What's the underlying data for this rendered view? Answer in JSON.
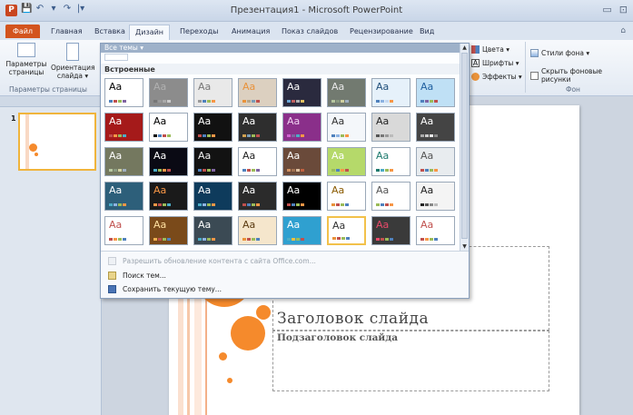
{
  "window": {
    "app_badge": "P",
    "title": "Презентация1 - Microsoft PowerPoint",
    "qat": [
      "💾",
      "↶",
      "▾",
      "↷",
      "|▾"
    ],
    "controls": [
      "▭",
      "⊡"
    ]
  },
  "tabs": [
    "Файл",
    "Главная",
    "Вставка",
    "Дизайн",
    "Переходы",
    "Анимация",
    "Показ слайдов",
    "Рецензирование",
    "Вид"
  ],
  "active_tab": "Дизайн",
  "ribbon": {
    "page_setup_btn": "Параметры страницы",
    "orientation_btn": "Ориентация слайда ▾",
    "page_setup_group": "Параметры страницы",
    "colors": "Цвета ▾",
    "fonts": "Шрифты ▾",
    "effects": "Эффекты ▾",
    "bg_styles": "Стили фона ▾",
    "hide_bg": "Скрыть фоновые рисунки",
    "bg_group": "Фон"
  },
  "theme_gallery": {
    "header": "Все темы ▾",
    "section": "Встроенные",
    "sample_text": "Aa",
    "themes": [
      {
        "bg": "#ffffff",
        "fg": "#000000",
        "dots": [
          "#4f81bd",
          "#c0504d",
          "#9bbb59",
          "#8064a2"
        ]
      },
      {
        "bg": "#8c8c8c",
        "fg": "#b0b0b0",
        "dots": [
          "#777",
          "#999",
          "#aaa",
          "#ccc"
        ]
      },
      {
        "bg": "#e9e9e9",
        "fg": "#777777",
        "dots": [
          "#999",
          "#4f81bd",
          "#9bbb59",
          "#f79646"
        ]
      },
      {
        "bg": "#dcd0c0",
        "fg": "#e9923a",
        "dots": [
          "#e9923a",
          "#b5a58a",
          "#7a9cb8",
          "#c0504d"
        ]
      },
      {
        "bg": "#2a2a3e",
        "fg": "#ffffff",
        "dots": [
          "#6aa6d6",
          "#c06060",
          "#b0b0b0",
          "#e0c060"
        ]
      },
      {
        "bg": "#727a70",
        "fg": "#e8e8e8",
        "dots": [
          "#b7c7a0",
          "#8a9a80",
          "#d0d0a0",
          "#a0b0c0"
        ]
      },
      {
        "bg": "#e6f1fa",
        "fg": "#1f4e79",
        "dots": [
          "#4f81bd",
          "#8db3e2",
          "#c6d9f1",
          "#f79646"
        ]
      },
      {
        "bg": "#bfe0f5",
        "fg": "#1f5f9f",
        "dots": [
          "#4f81bd",
          "#8064a2",
          "#9bbb59",
          "#c0504d"
        ]
      },
      {
        "bg": "#a51a1a",
        "fg": "#ffffff",
        "dots": [
          "#c0504d",
          "#f79646",
          "#9bbb59",
          "#4bacc6"
        ]
      },
      {
        "bg": "#ffffff",
        "fg": "#000000",
        "dots": [
          "#000",
          "#4f81bd",
          "#c0504d",
          "#9bbb59"
        ]
      },
      {
        "bg": "#111111",
        "fg": "#ffffff",
        "dots": [
          "#c0504d",
          "#4f81bd",
          "#9bbb59",
          "#f79646"
        ]
      },
      {
        "bg": "#2e2e2e",
        "fg": "#ffffff",
        "dots": [
          "#d0a050",
          "#7a9cb8",
          "#9bbb59",
          "#c0504d"
        ]
      },
      {
        "bg": "#8a2f8a",
        "fg": "#f0d0f0",
        "dots": [
          "#d060d0",
          "#8064a2",
          "#4bacc6",
          "#f79646"
        ]
      },
      {
        "bg": "#f4f7fa",
        "fg": "#333333",
        "dots": [
          "#4f81bd",
          "#8db3e2",
          "#9bbb59",
          "#f79646"
        ]
      },
      {
        "bg": "#d9d9d9",
        "fg": "#222222",
        "dots": [
          "#555",
          "#777",
          "#999",
          "#bbb"
        ]
      },
      {
        "bg": "#444444",
        "fg": "#ffffff",
        "dots": [
          "#aaa",
          "#ccc",
          "#eee",
          "#888"
        ]
      },
      {
        "bg": "#74785f",
        "fg": "#ffffff",
        "dots": [
          "#b7c7a0",
          "#8a9a80",
          "#d0d0a0",
          "#a0b0c0"
        ]
      },
      {
        "bg": "#0a0a14",
        "fg": "#ffffff",
        "dots": [
          "#4bacc6",
          "#9bbb59",
          "#f79646",
          "#c0504d"
        ]
      },
      {
        "bg": "#121212",
        "fg": "#f2f2f2",
        "dots": [
          "#4f81bd",
          "#c0504d",
          "#9bbb59",
          "#8064a2"
        ]
      },
      {
        "bg": "#ffffff",
        "fg": "#222222",
        "dots": [
          "#4f81bd",
          "#c0504d",
          "#9bbb59",
          "#8064a2"
        ]
      },
      {
        "bg": "#6a4a3a",
        "fg": "#ffffff",
        "dots": [
          "#d09060",
          "#a07050",
          "#e0c0a0",
          "#c06040"
        ]
      },
      {
        "bg": "#b5d96a",
        "fg": "#ffffff",
        "dots": [
          "#9bbb59",
          "#4f81bd",
          "#f79646",
          "#c0504d"
        ]
      },
      {
        "bg": "#ffffff",
        "fg": "#1e7a6e",
        "dots": [
          "#1e7a6e",
          "#4bacc6",
          "#9bbb59",
          "#f79646"
        ]
      },
      {
        "bg": "#e8ecef",
        "fg": "#555555",
        "dots": [
          "#c0504d",
          "#4f81bd",
          "#9bbb59",
          "#f79646"
        ]
      },
      {
        "bg": "#2d5f7a",
        "fg": "#ffffff",
        "dots": [
          "#4bacc6",
          "#8db3e2",
          "#9bbb59",
          "#f79646"
        ]
      },
      {
        "bg": "#1a1a1a",
        "fg": "#f79646",
        "dots": [
          "#f79646",
          "#c0504d",
          "#9bbb59",
          "#4bacc6"
        ]
      },
      {
        "bg": "#0e3b5c",
        "fg": "#ffffff",
        "dots": [
          "#4bacc6",
          "#8db3e2",
          "#9bbb59",
          "#f79646"
        ]
      },
      {
        "bg": "#2b2b2b",
        "fg": "#ffffff",
        "dots": [
          "#c0504d",
          "#4f81bd",
          "#9bbb59",
          "#f79646"
        ]
      },
      {
        "bg": "#000000",
        "fg": "#ffffff",
        "dots": [
          "#c0504d",
          "#4f81bd",
          "#9bbb59",
          "#f79646"
        ]
      },
      {
        "bg": "#ffffff",
        "fg": "#8a5a00",
        "dots": [
          "#e9923a",
          "#c0504d",
          "#9bbb59",
          "#4f81bd"
        ]
      },
      {
        "bg": "#ffffff",
        "fg": "#555555",
        "dots": [
          "#9bbb59",
          "#4f81bd",
          "#c0504d",
          "#f79646"
        ]
      },
      {
        "bg": "#f4f4f4",
        "fg": "#222222",
        "dots": [
          "#222",
          "#555",
          "#888",
          "#bbb"
        ]
      },
      {
        "bg": "#ffffff",
        "fg": "#c0504d",
        "dots": [
          "#c0504d",
          "#f79646",
          "#9bbb59",
          "#4f81bd"
        ]
      },
      {
        "bg": "#7a4a1a",
        "fg": "#ffe0a0",
        "dots": [
          "#f0b050",
          "#c0504d",
          "#9bbb59",
          "#4f81bd"
        ]
      },
      {
        "bg": "#3b4a54",
        "fg": "#ffffff",
        "dots": [
          "#4bacc6",
          "#8db3e2",
          "#9bbb59",
          "#f79646"
        ]
      },
      {
        "bg": "#f5e6cc",
        "fg": "#5a3a10",
        "dots": [
          "#e9923a",
          "#c0504d",
          "#9bbb59",
          "#4f81bd"
        ]
      },
      {
        "bg": "#2fa0d0",
        "fg": "#ffffff",
        "dots": [
          "#4bacc6",
          "#f0c040",
          "#9bbb59",
          "#c0504d"
        ]
      },
      {
        "bg": "#ffffff",
        "fg": "#333333",
        "dots": [
          "#e9923a",
          "#c0504d",
          "#9bbb59",
          "#4f81bd"
        ]
      },
      {
        "bg": "#3a3a3a",
        "fg": "#e84a6a",
        "dots": [
          "#e84a6a",
          "#c0504d",
          "#9bbb59",
          "#4f81bd"
        ]
      },
      {
        "bg": "#ffffff",
        "fg": "#c0504d",
        "dots": [
          "#c0504d",
          "#f79646",
          "#9bbb59",
          "#4f81bd"
        ]
      }
    ],
    "menu": [
      {
        "label": "Разрешить обновление контента с сайта Office.com...",
        "disabled": true
      },
      {
        "label": "Поиск тем...",
        "disabled": false
      },
      {
        "label": "Сохранить текущую тему...",
        "disabled": false
      }
    ]
  },
  "thumbnail": {
    "number": "1"
  },
  "slide": {
    "title": "Заголовок слайда",
    "subtitle": "Подзаголовок слайда",
    "accent": "#f58a2c"
  }
}
